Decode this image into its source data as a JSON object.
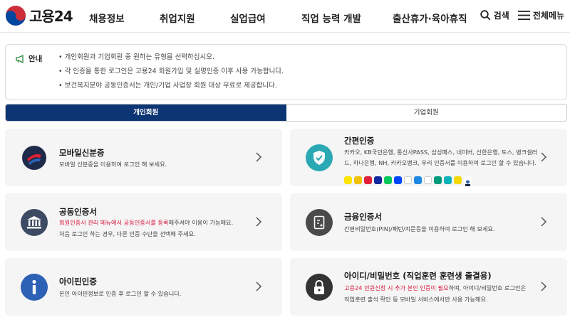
{
  "header": {
    "logo_text": "고용24",
    "nav": [
      "채용정보",
      "취업지원",
      "실업급여",
      "직업 능력 개발",
      "출산휴가·육아휴직"
    ],
    "search_label": "검색",
    "menu_label": "전체메뉴"
  },
  "notice": {
    "label": "안내",
    "items": [
      "개인회원과 기업회원 중 원하는 유형을 선택하십시오.",
      "각 인증을 통한 로그인은 고용24 회원가입 및 실명인증 이후 사용 가능합니다.",
      "보건복지분야 공동인증서는 개인/기업 사업장 회원 대상 무료로 제공합니다."
    ]
  },
  "tabs": [
    {
      "label": "개인회원",
      "active": true
    },
    {
      "label": "기업회원",
      "active": false
    }
  ],
  "cards": {
    "mobile_id": {
      "title": "모바일신분증",
      "desc": "모바일 신분증을 이용하여 로그인 해 보세요."
    },
    "simple_auth": {
      "title": "간편인증",
      "desc1": "카카오, KB국민은행, 통신사PASS, 삼성패스, 네이버, 신한은행, 토스, 뱅크샐러",
      "desc2": "드, 하나은행, NH, 카카오뱅크, 우리 인증서를 이용하여 로그인 할 수 있습니다."
    },
    "joint_cert": {
      "title": "공동인증서",
      "desc1_red": "회원인증서 관리 메뉴에서 공동인증서를 등록",
      "desc1_rest": "해주셔야 이용이 가능해요.",
      "desc2": "처음 로그인 하는 경우, 다른 인증 수단을 선택해 주세요."
    },
    "financial_cert": {
      "title": "금융인증서",
      "desc": "간편비밀번호(PIN)/패턴/지문등을 이용하여 로그인 해 보세요."
    },
    "ipin": {
      "title": "아이핀인증",
      "desc": "본인 아이핀정보로 인증 후 로그인 할 수 있습니다."
    },
    "id_pw": {
      "title": "아이디/비밀번호 (직업훈련 훈련생 출결용)",
      "desc1_red": "고용24 민원신청 시 추가 본인 인증이 필요",
      "desc1_rest": "하며, 아이디/비밀번호 로그인은",
      "desc2": "직업훈련 출석 확인 등 모바일 서비스에서만 사용 가능해요."
    }
  },
  "colors": {
    "accent": "#0c3573",
    "red": "#d6173b",
    "teal": "#2aa8b4",
    "slate": "#3d4a63",
    "blue": "#2c61b5"
  },
  "icons": [
    "megaphone-icon",
    "search-icon",
    "hamburger-icon",
    "mobile-id-icon",
    "shield-check-icon",
    "bank-building-icon",
    "document-icon",
    "info-icon",
    "lock-icon",
    "chevron-right-icon"
  ]
}
